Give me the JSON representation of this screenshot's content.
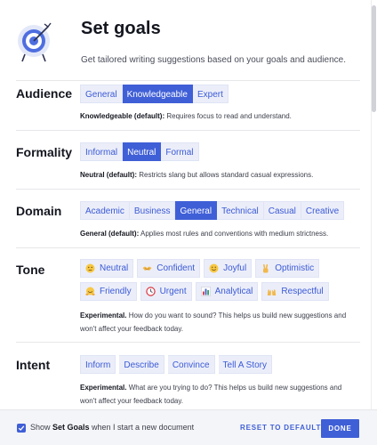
{
  "header": {
    "title": "Set goals",
    "subtitle": "Get tailored writing suggestions based on your goals and audience.",
    "icon": "target-icon"
  },
  "audience": {
    "label": "Audience",
    "options": [
      "General",
      "Knowledgeable",
      "Expert"
    ],
    "selected": "Knowledgeable",
    "desc_strong": "Knowledgeable (default):",
    "desc_text": " Requires focus to read and understand."
  },
  "formality": {
    "label": "Formality",
    "options": [
      "Informal",
      "Neutral",
      "Formal"
    ],
    "selected": "Neutral",
    "desc_strong": "Neutral (default):",
    "desc_text": " Restricts slang but allows standard casual expressions."
  },
  "domain": {
    "label": "Domain",
    "options": [
      "Academic",
      "Business",
      "General",
      "Technical",
      "Casual",
      "Creative"
    ],
    "selected": "General",
    "desc_strong": "General (default):",
    "desc_text": " Applies most rules and conventions with medium strictness."
  },
  "tone": {
    "label": "Tone",
    "row1": [
      "Neutral",
      "Confident",
      "Joyful",
      "Optimistic"
    ],
    "row2": [
      "Friendly",
      "Urgent",
      "Analytical",
      "Respectful"
    ],
    "icons_row1": [
      "neutral-face-icon",
      "handshake-icon",
      "smiling-face-icon",
      "victory-hand-icon"
    ],
    "icons_row2": [
      "hugging-face-icon",
      "clock-icon",
      "bar-chart-icon",
      "raised-hands-icon"
    ],
    "desc_strong": "Experimental.",
    "desc_line1": " How do you want to sound? This helps us build new suggestions and",
    "desc_line2": "won't affect your feedback today."
  },
  "intent": {
    "label": "Intent",
    "options": [
      "Inform",
      "Describe",
      "Convince",
      "Tell A Story"
    ],
    "desc_strong": "Experimental.",
    "desc_line1": " What are you trying to do? This helps us build new suggestions and",
    "desc_line2": "won't affect your feedback today."
  },
  "footer": {
    "checkbox_checked": true,
    "show_prefix": "Show ",
    "show_bold": "Set Goals",
    "show_suffix": " when I start a new document",
    "reset_label": "RESET TO DEFAULTS",
    "done_label": "DONE"
  },
  "colors": {
    "accent": "#3f5fd7",
    "chip_bg": "#ebeef9"
  }
}
